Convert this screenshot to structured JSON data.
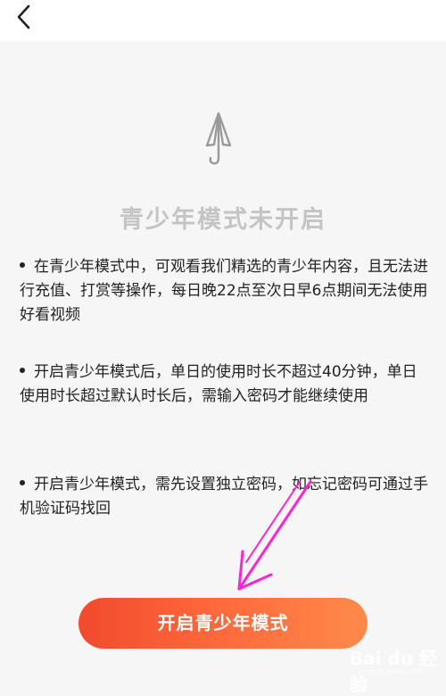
{
  "header": {
    "back_icon": "chevron-left-icon"
  },
  "status": {
    "icon": "umbrella-icon",
    "title": "青少年模式未开启"
  },
  "info": {
    "items": [
      "在青少年模式中，可观看我们精选的青少年内容，且无法进行充值、打赏等操作，每日晚22点至次日早6点期间无法使用好看视频",
      "开启青少年模式后，单日的使用时长不超过40分钟，单日使用时长超过默认时长后，需输入密码才能继续使用",
      "开启青少年模式，需先设置独立密码，如忘记密码可通过手机验证码找回"
    ]
  },
  "action": {
    "start_label": "开启青少年模式"
  },
  "watermark": {
    "brand": "Bai du 经验",
    "url": "jingyan.baidu.com"
  },
  "colors": {
    "button_start": "#f24a2e",
    "button_end": "#ff8a4a",
    "title_gray": "#c4c4c4",
    "annotation_arrow": "#ff22d6"
  }
}
